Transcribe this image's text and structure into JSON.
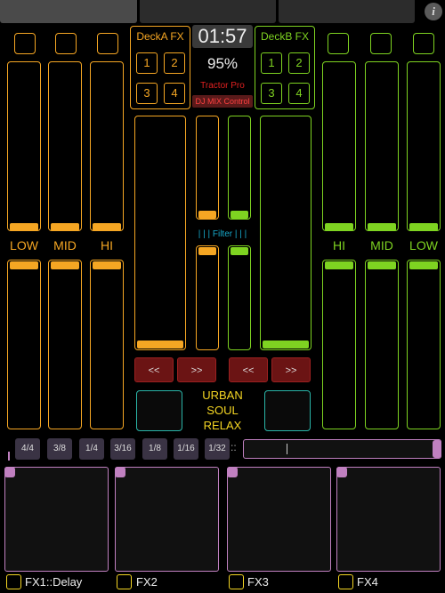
{
  "colors": {
    "deck_a": "#f5a623",
    "deck_b": "#7ed321",
    "filter": "#17a8c9",
    "fx_pad": "#c080c0",
    "genre": "#f5d623"
  },
  "header": {
    "info_icon": "i"
  },
  "deck_a": {
    "fx_title": "DeckA FX",
    "fx_buttons": [
      "1",
      "2",
      "3",
      "4"
    ],
    "eq_labels": {
      "low": "LOW",
      "mid": "MID",
      "hi": "HI"
    },
    "seek_back": "<<",
    "seek_fwd": ">>"
  },
  "deck_b": {
    "fx_title": "DeckB FX",
    "fx_buttons": [
      "1",
      "2",
      "3",
      "4"
    ],
    "eq_labels": {
      "hi": "HI",
      "mid": "MID",
      "low": "LOW"
    },
    "seek_back": "<<",
    "seek_fwd": ">>"
  },
  "center": {
    "timer": "01:57",
    "percent": "95%",
    "brand": "Tractor Pro",
    "mix_control": "DJ MIX Control",
    "filter_label": "| | | Filter | | |",
    "genre": [
      "URBAN",
      "SOUL",
      "RELAX"
    ]
  },
  "beat_buttons": [
    "4/4",
    "3/8",
    "1/4",
    "3/16",
    "1/8",
    "1/16",
    "1/32"
  ],
  "beat_separator": "::",
  "fx_pads": [
    "FX1::Delay",
    "FX2",
    "FX3",
    "FX4"
  ]
}
